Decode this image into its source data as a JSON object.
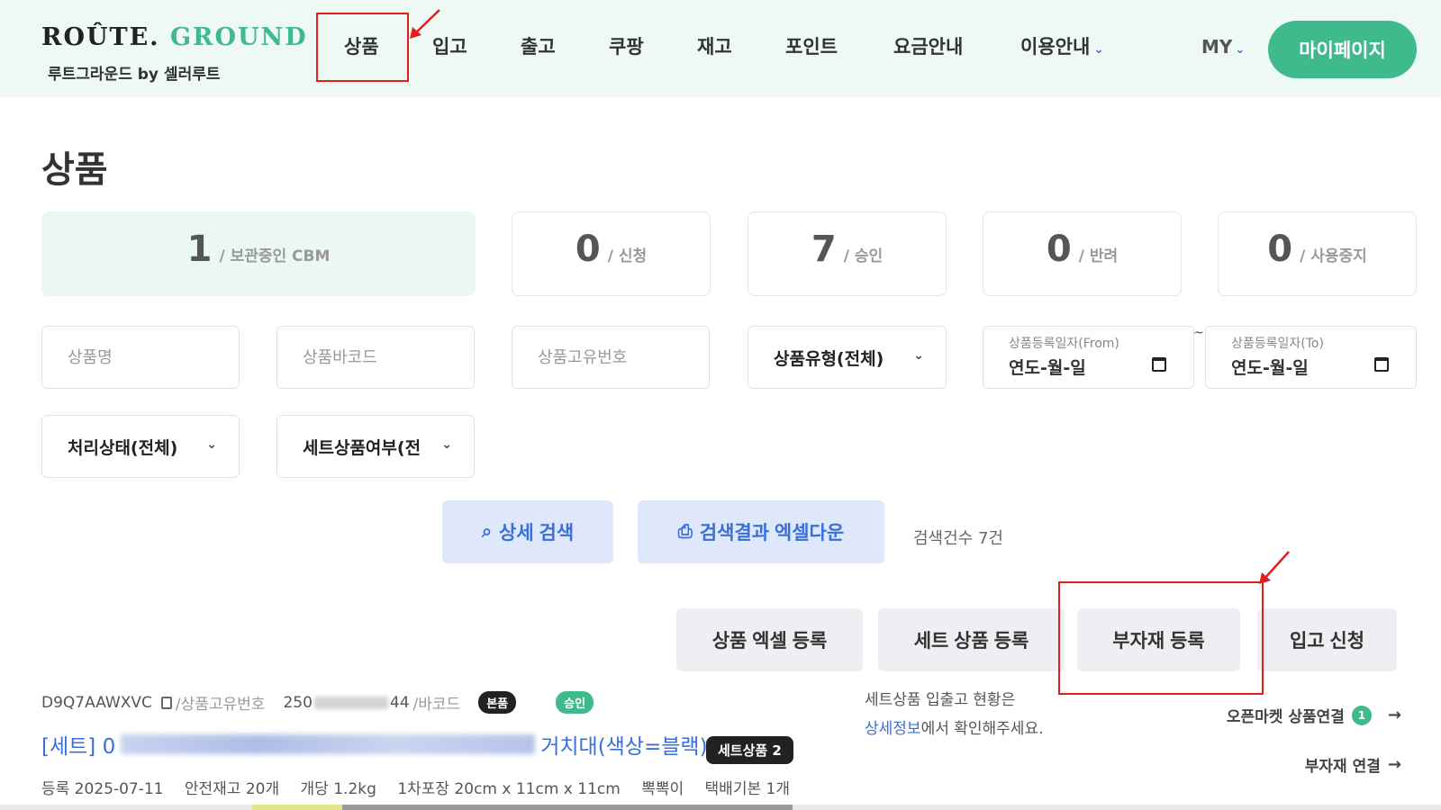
{
  "header": {
    "logo_part1": "ROÛTE.",
    "logo_part2": "GROUND",
    "logo_sub": "루트그라운드 by 셀러루트",
    "nav": [
      "상품",
      "입고",
      "출고",
      "쿠팡",
      "재고",
      "포인트",
      "요금안내",
      "이용안내"
    ],
    "my_label": "MY",
    "mypage_button": "마이페이지"
  },
  "page_title": "상품",
  "stats": [
    {
      "value": "1",
      "label": "/ 보관중인 CBM"
    },
    {
      "value": "0",
      "label": "/ 신청"
    },
    {
      "value": "7",
      "label": "/ 승인"
    },
    {
      "value": "0",
      "label": "/ 반려"
    },
    {
      "value": "0",
      "label": "/ 사용중지"
    }
  ],
  "filters": {
    "product_name_placeholder": "상품명",
    "barcode_placeholder": "상품바코드",
    "unique_no_placeholder": "상품고유번호",
    "product_type": "상품유형(전체)",
    "date_from_label": "상품등록일자(From)",
    "date_to_label": "상품등록일자(To)",
    "date_placeholder": "연도-월-일",
    "date_separator": "~",
    "status": "처리상태(전체)",
    "set_yn": "세트상품여부(전"
  },
  "actions": {
    "detail_search": "상세 검색",
    "excel_download": "검색결과 엑셀다운",
    "result_count": "검색건수 7건",
    "excel_register": "상품 엑셀 등록",
    "set_register": "세트 상품 등록",
    "material_register": "부자재 등록",
    "inbound_request": "입고 신청"
  },
  "product": {
    "unique_no": "D9Q7AAWXVC",
    "unique_no_suffix": "/상품고유번호",
    "barcode_prefix": "250",
    "barcode_end": "44",
    "barcode_suffix": "/바코드",
    "badge_main": "본품",
    "badge_status": "승인",
    "title_prefix": "[세트] 0",
    "title_suffix": "거치대(색상=블랙)",
    "set_badge": "세트상품 2",
    "specs": [
      "등록 2025-07-11",
      "안전재고 20개",
      "개당 1.2kg",
      "1차포장 20cm x 11cm x 11cm",
      "뽁뽁이",
      "택배기본 1개"
    ]
  },
  "set_notice": {
    "line1": "세트상품 입출고 현황은",
    "link": "상세정보",
    "line2_rest": "에서 확인해주세요."
  },
  "side_links": {
    "openmarket": "오픈마켓 상품연결",
    "openmarket_count": "1",
    "material_link": "부자재 연결"
  },
  "colors": {
    "brand_green": "#3fba8d",
    "accent_blue": "#3a6fd8",
    "annotation_red": "#e41e1e"
  }
}
